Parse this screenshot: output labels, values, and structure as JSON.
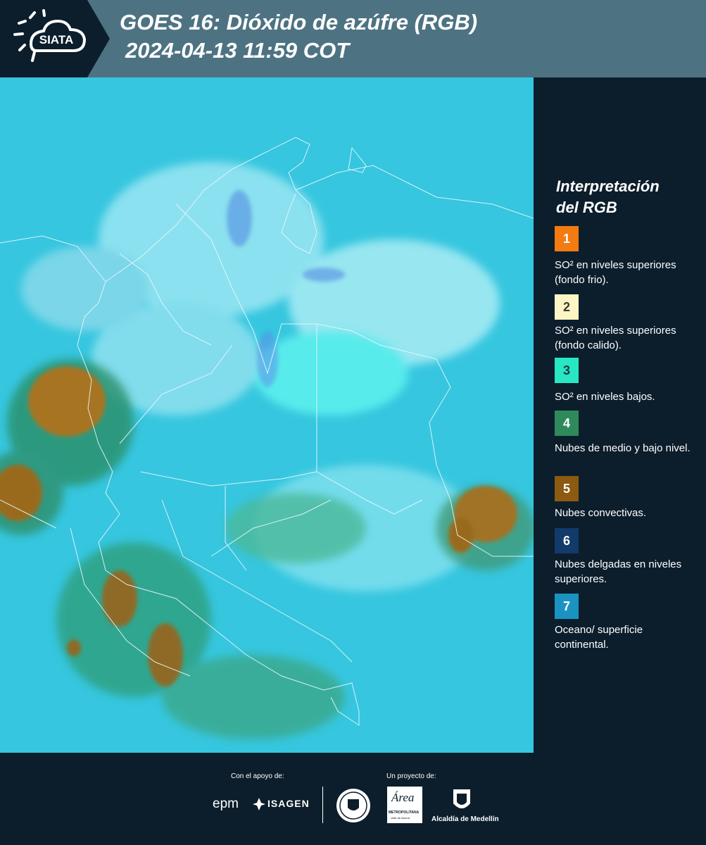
{
  "header": {
    "logo_text": "SIATA",
    "title": "GOES 16: Dióxido de azúfre (RGB)",
    "datetime": "2024-04-13 11:59 COT"
  },
  "legend": {
    "title_line1": "Interpretación",
    "title_line2": "del RGB",
    "items": [
      {
        "number": "1",
        "label": "SO² en niveles superiores (fondo frio).",
        "color": "#f47b12",
        "text_color": "#ffffff"
      },
      {
        "number": "2",
        "label": "SO² en niveles superiores (fondo calido).",
        "color": "#fdf6c4",
        "text_color": "#3a3a3a"
      },
      {
        "number": "3",
        "label": "SO² en niveles bajos.",
        "color": "#27e8c3",
        "text_color": "#1d3b3b"
      },
      {
        "number": "4",
        "label": "Nubes de medio y bajo nivel.",
        "color": "#2f8a5b",
        "text_color": "#ffffff"
      },
      {
        "number": "5",
        "label": "Nubes convectivas.",
        "color": "#8c5a10",
        "text_color": "#ffffff"
      },
      {
        "number": "6",
        "label": "Nubes delgadas en niveles superiores.",
        "color": "#123a6a",
        "text_color": "#ffffff"
      },
      {
        "number": "7",
        "label": "Oceano/ superficie continental.",
        "color": "#1a93c2",
        "text_color": "#ffffff"
      }
    ]
  },
  "footer": {
    "support_label": "Con el apoyo de:",
    "project_label": "Un proyecto de:",
    "sponsor1": "epm",
    "sponsor2": "ISAGEN",
    "partner_area": "Área",
    "partner_area_sub": "METROPOLITANA",
    "partner_area_sub2": "Valle de Aburrá",
    "partner_alcaldia": "Alcaldía de Medellín"
  },
  "colors": {
    "header_bg": "#4d7382",
    "page_bg": "#0c1e2c",
    "map_base": "#35c8df"
  }
}
